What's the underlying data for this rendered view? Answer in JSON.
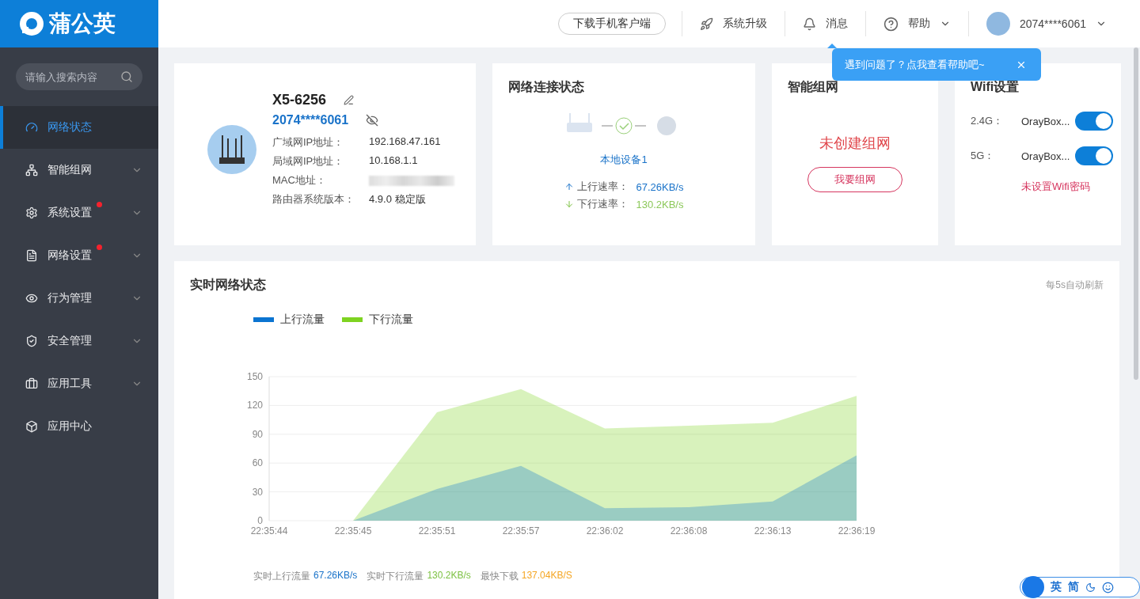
{
  "logo": {
    "text": "蒲公英"
  },
  "sidebar": {
    "search": {
      "placeholder": "请输入搜索内容"
    },
    "items": [
      {
        "label": "网络状态",
        "selected": true,
        "dot": false,
        "expandable": false
      },
      {
        "label": "智能组网",
        "selected": false,
        "dot": false,
        "expandable": true
      },
      {
        "label": "系统设置",
        "selected": false,
        "dot": true,
        "expandable": true
      },
      {
        "label": "网络设置",
        "selected": false,
        "dot": true,
        "expandable": true
      },
      {
        "label": "行为管理",
        "selected": false,
        "dot": false,
        "expandable": true
      },
      {
        "label": "安全管理",
        "selected": false,
        "dot": false,
        "expandable": true
      },
      {
        "label": "应用工具",
        "selected": false,
        "dot": false,
        "expandable": true
      },
      {
        "label": "应用中心",
        "selected": false,
        "dot": false,
        "expandable": false
      }
    ]
  },
  "header": {
    "download": "下载手机客户端",
    "upgrade": "系统升级",
    "messages": "消息",
    "help": "帮助",
    "user": "2074****6061"
  },
  "tooltip": {
    "text": "遇到问题了？点我查看帮助吧~"
  },
  "device": {
    "name": "X5-6256",
    "sn": "2074****6061",
    "fields": [
      {
        "label": "广域网IP地址：",
        "value": "192.168.47.161"
      },
      {
        "label": "局域网IP地址：",
        "value": "10.168.1.1"
      },
      {
        "label": "MAC地址：",
        "blurred": true
      },
      {
        "label": "路由器系统版本：",
        "value": "4.9.0 稳定版"
      }
    ]
  },
  "connection": {
    "title": "网络连接状态",
    "device": "本地设备1",
    "up_label": "上行速率：",
    "up_value": "67.26KB/s",
    "down_label": "下行速率：",
    "down_value": "130.2KB/s"
  },
  "mesh": {
    "title": "智能组网",
    "status": "未创建组网",
    "button": "我要组网"
  },
  "wifi": {
    "title": "Wifi设置",
    "bands": [
      {
        "band": "2.4G：",
        "ssid": "OrayBox...",
        "on": true
      },
      {
        "band": "5G：",
        "ssid": "OrayBox...",
        "on": true
      }
    ],
    "warning": "未设置Wifi密码"
  },
  "traffic": {
    "title": "实时网络状态",
    "refresh": "每5s自动刷新",
    "chart_data": {
      "type": "area",
      "categories": [
        "22:35:44",
        "22:35:45",
        "22:35:51",
        "22:35:57",
        "22:36:02",
        "22:36:08",
        "22:36:13",
        "22:36:19"
      ],
      "series": [
        {
          "name": "上行流量",
          "color": "#0b74d1",
          "values": [
            0,
            0,
            33,
            57,
            13,
            14,
            20,
            68
          ]
        },
        {
          "name": "下行流量",
          "color": "#7ed321",
          "values": [
            0,
            0,
            113,
            137,
            96,
            99,
            102,
            130
          ]
        }
      ],
      "ylim": [
        0,
        150
      ],
      "yticks": [
        0,
        30,
        60,
        90,
        120,
        150
      ],
      "grid": true
    },
    "stats": [
      {
        "label": "实时上行流量",
        "value": "67.26KB/s",
        "color": "#1a73c9"
      },
      {
        "label": "实时下行流量",
        "value": "130.2KB/s",
        "color": "#7cc142"
      },
      {
        "label": "最快下载",
        "value": "137.04KB/S",
        "color": "#f5a623"
      }
    ]
  },
  "ime": {
    "lang": "英",
    "script": "简"
  }
}
